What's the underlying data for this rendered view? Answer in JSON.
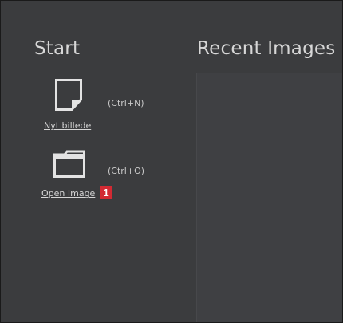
{
  "start": {
    "title": "Start",
    "actions": [
      {
        "label": "Nyt billede",
        "shortcut": "(Ctrl+N)",
        "icon": "new-document-icon"
      },
      {
        "label": "Open Image",
        "shortcut": "(Ctrl+O)",
        "icon": "folder-icon",
        "badge": "1"
      }
    ]
  },
  "recent": {
    "title": "Recent Images"
  },
  "colors": {
    "background": "#3b3c3e",
    "panel": "#3f4043",
    "text": "#d7d7d7",
    "badge": "#d22a33"
  }
}
